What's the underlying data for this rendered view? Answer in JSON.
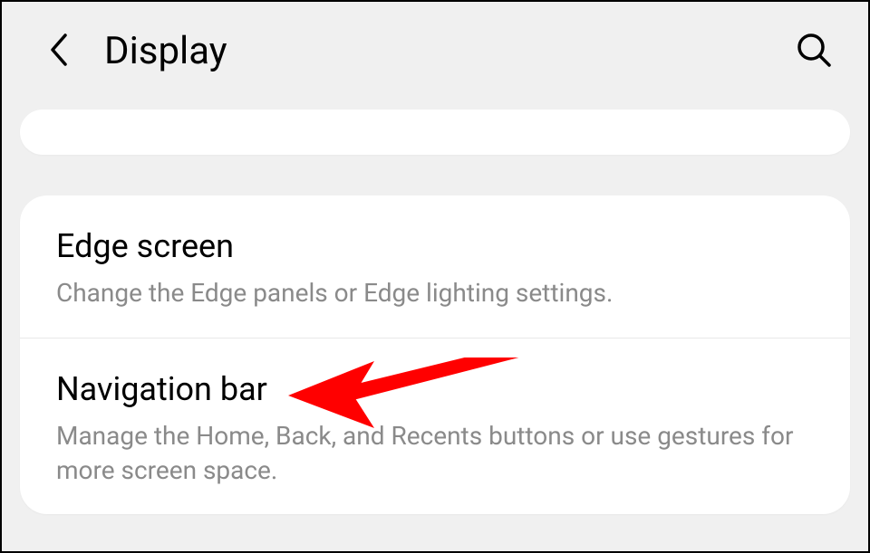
{
  "header": {
    "title": "Display"
  },
  "items": [
    {
      "title": "Edge screen",
      "description": "Change the Edge panels or Edge lighting settings."
    },
    {
      "title": "Navigation bar",
      "description": "Manage the Home, Back, and Recents buttons or use gestures for more screen space."
    }
  ]
}
